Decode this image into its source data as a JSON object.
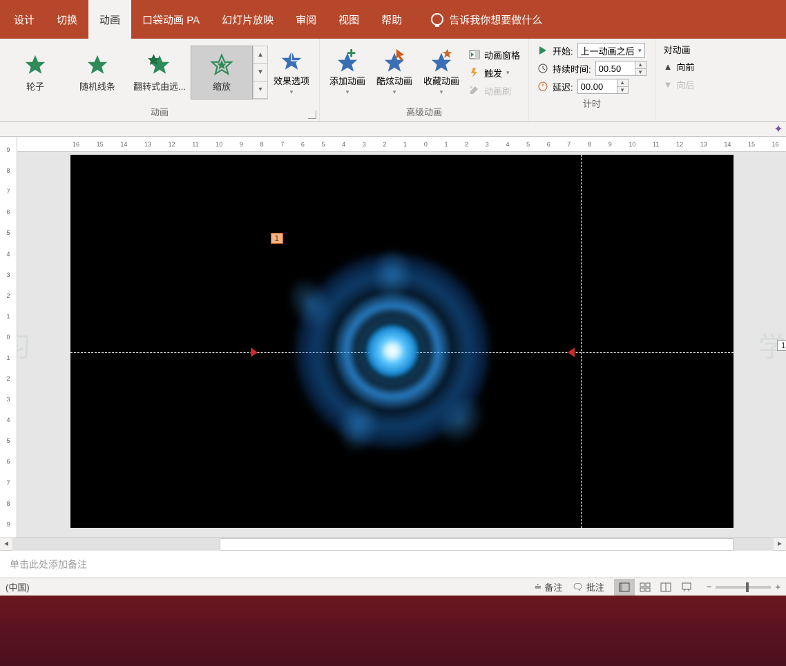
{
  "tabs": {
    "design": "设计",
    "transition": "切换",
    "animation": "动画",
    "pocket": "口袋动画 PA",
    "slideshow": "幻灯片放映",
    "review": "审阅",
    "view": "视图",
    "help": "帮助",
    "tell_me": "告诉我你想要做什么"
  },
  "ribbon": {
    "gallery": {
      "wheel": "轮子",
      "random_bars": "随机线条",
      "flip": "翻转式由远...",
      "zoom": "缩放"
    },
    "effect_options": "效果选项",
    "animation_group": "动画",
    "add_animation": "添加动画",
    "cool_animation": "酷炫动画",
    "fav_animation": "收藏动画",
    "adv_group": "高级动画",
    "anim_pane": "动画窗格",
    "trigger": "触发",
    "anim_painter": "动画刷",
    "timing_group": "计时",
    "start_label": "开始:",
    "start_value": "上一动画之后",
    "duration_label": "持续时间:",
    "duration_value": "00.50",
    "delay_label": "延迟:",
    "delay_value": "00.00",
    "reorder_label": "对动画",
    "move_earlier": "向前",
    "move_later": "向后"
  },
  "ruler_h": [
    "16",
    "15",
    "14",
    "13",
    "12",
    "11",
    "10",
    "9",
    "8",
    "7",
    "6",
    "5",
    "4",
    "3",
    "2",
    "1",
    "0",
    "1",
    "2",
    "3",
    "4",
    "5",
    "6",
    "7",
    "8",
    "9",
    "10",
    "11",
    "12",
    "13",
    "14",
    "15",
    "16"
  ],
  "ruler_v": [
    "9",
    "8",
    "7",
    "6",
    "5",
    "4",
    "3",
    "2",
    "1",
    "0",
    "1",
    "2",
    "3",
    "4",
    "5",
    "6",
    "7",
    "8",
    "9"
  ],
  "slide": {
    "tag1": "1",
    "indicator": "1"
  },
  "notes_placeholder": "单击此处添加备注",
  "status": {
    "lang": "(中国)",
    "notes": "备注",
    "comments": "批注"
  },
  "wm_left": "习",
  "wm_right": "学习"
}
